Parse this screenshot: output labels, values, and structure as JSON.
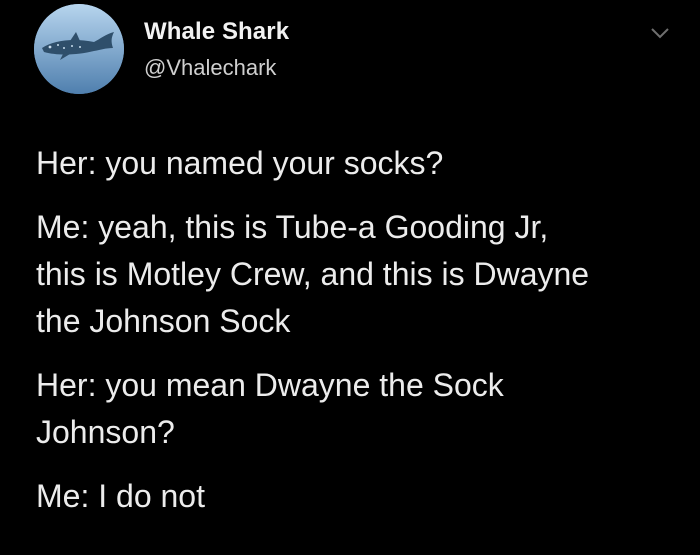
{
  "author": {
    "name": "Whale Shark",
    "handle": "@Vhalechark"
  },
  "tweet": {
    "lines": [
      "Her: you named your socks?",
      "Me: yeah, this is Tube-a Gooding Jr,",
      "this is Motley Crew, and this is Dwayne",
      "the Johnson Sock",
      "Her: you mean Dwayne the Sock",
      "Johnson?",
      "Me: I do not"
    ]
  },
  "colors": {
    "background": "#000000",
    "text": "#ececec",
    "handle": "#cfcfcf"
  },
  "icons": {
    "avatar": "whale-shark-avatar",
    "menu": "chevron-down-icon"
  }
}
